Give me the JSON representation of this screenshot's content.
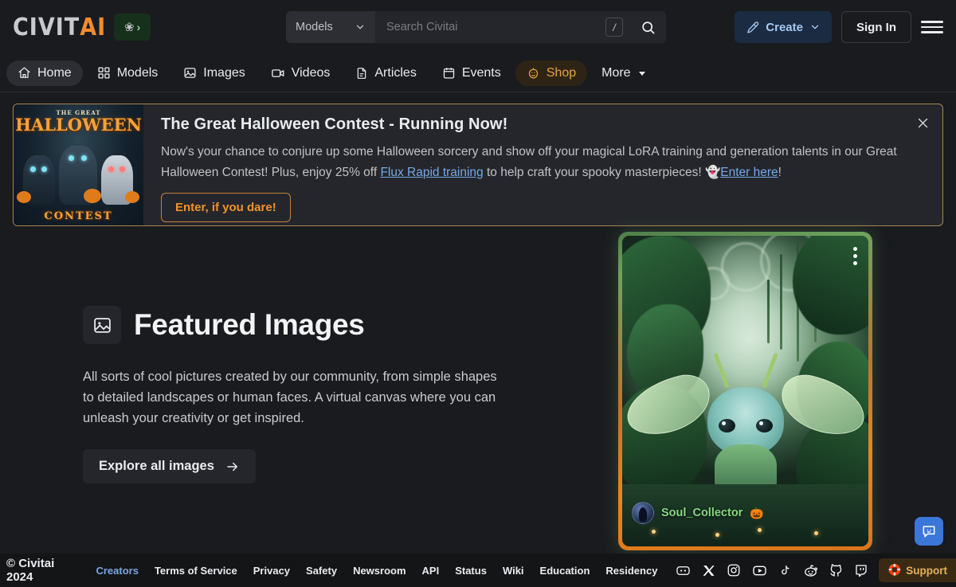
{
  "header": {
    "logo": {
      "part1": "CIVIT",
      "part2": "AI",
      "badge_icon": "flower-icon",
      "badge_chevron": "›"
    },
    "search": {
      "category_label": "Models",
      "placeholder": "Search Civitai",
      "value": "",
      "shortcut_key": "/",
      "search_icon": "search-icon"
    },
    "create_label": "Create",
    "signin_label": "Sign In",
    "menu_icon": "hamburger-menu-icon"
  },
  "nav": {
    "items": [
      {
        "label": "Home",
        "icon": "home-icon",
        "active": true
      },
      {
        "label": "Models",
        "icon": "grid-icon",
        "active": false
      },
      {
        "label": "Images",
        "icon": "image-icon",
        "active": false
      },
      {
        "label": "Videos",
        "icon": "video-icon",
        "active": false
      },
      {
        "label": "Articles",
        "icon": "document-icon",
        "active": false
      },
      {
        "label": "Events",
        "icon": "calendar-icon",
        "active": false
      },
      {
        "label": "Shop",
        "icon": "pumpkin-icon",
        "active": false
      },
      {
        "label": "More",
        "icon": "chevron-down-icon",
        "active": false
      }
    ]
  },
  "banner": {
    "image_alt": "The Great Halloween Contest poster",
    "image_title_top": "THE GREAT",
    "image_title_main": "HALLOWEEN",
    "image_title_bottom": "CONTEST",
    "title": "The Great Halloween Contest - Running Now!",
    "text_part1": "Now's your chance to conjure up some Halloween sorcery and show off your magical LoRA training and generation talents in our Great Halloween Contest! Plus, enjoy 25% off ",
    "link1": "Flux Rapid training",
    "text_part2": " to help craft your spooky masterpieces! 👻",
    "link2": "Enter here",
    "text_part3": "!",
    "button_label": "Enter, if you dare!",
    "close_icon": "close-icon"
  },
  "featured": {
    "icon": "image-icon",
    "title": "Featured Images",
    "description": "All sorts of cool pictures created by our community, from simple shapes to detailed landscapes or human faces. A virtual canvas where you can unleash your creativity or get inspired.",
    "cta_label": "Explore all images",
    "cta_icon": "arrow-right-icon"
  },
  "card": {
    "image_alt": "Green fairy creature with wings in a lush forest",
    "menu_icon": "three-dots-vertical-icon",
    "username": "Soul_Collector",
    "badge_emoji": "🎃",
    "avatar_icon": "user-avatar"
  },
  "chat_fab": {
    "icon": "chat-smiley-icon"
  },
  "footer": {
    "copyright": "© Civitai 2024",
    "links": [
      {
        "label": "Creators",
        "accent": true
      },
      {
        "label": "Terms of Service",
        "accent": false
      },
      {
        "label": "Privacy",
        "accent": false
      },
      {
        "label": "Safety",
        "accent": false
      },
      {
        "label": "Newsroom",
        "accent": false
      },
      {
        "label": "API",
        "accent": false
      },
      {
        "label": "Status",
        "accent": false
      },
      {
        "label": "Wiki",
        "accent": false
      },
      {
        "label": "Education",
        "accent": false
      },
      {
        "label": "Residency",
        "accent": false
      }
    ],
    "socials": [
      {
        "name": "discord-icon"
      },
      {
        "name": "x-twitter-icon"
      },
      {
        "name": "instagram-icon"
      },
      {
        "name": "youtube-icon"
      },
      {
        "name": "tiktok-icon"
      },
      {
        "name": "reddit-icon"
      },
      {
        "name": "github-icon"
      },
      {
        "name": "twitch-icon"
      }
    ],
    "support_label": "Support",
    "support_emoji": "🛟"
  },
  "colors": {
    "background": "#1a1b1e",
    "surface": "#25262b",
    "accent_orange": "#f08c2e",
    "accent_blue": "#74a8e8",
    "accent_amber": "#e8a33d",
    "username_green": "#86d77f"
  }
}
